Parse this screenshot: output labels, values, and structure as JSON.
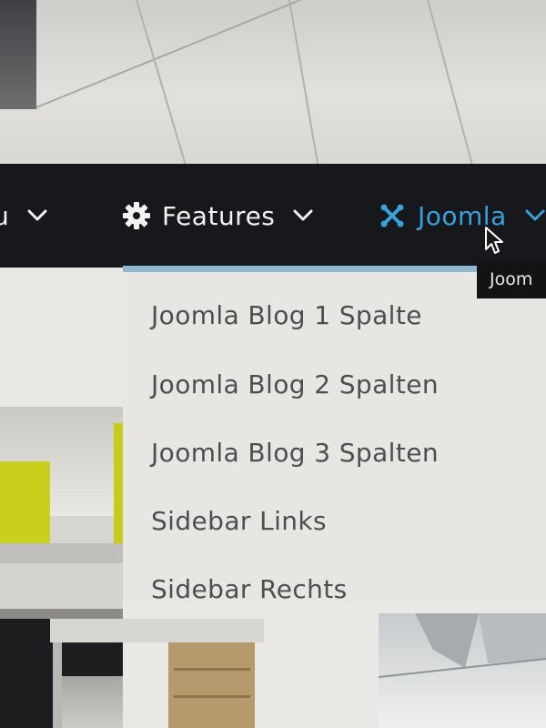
{
  "navbar": {
    "items": [
      {
        "label": "u",
        "icon": "chevron-down-icon"
      },
      {
        "label": "Features",
        "icon": "gear-icon"
      },
      {
        "label": "Joomla",
        "icon": "joomla-logo-icon"
      }
    ],
    "active_color": "#3aa0dc",
    "background": "#16181b"
  },
  "tooltip": {
    "text": "Joom"
  },
  "dropdown": {
    "accent_color": "#8fb8d0",
    "items": [
      {
        "label": "Joomla Blog 1 Spalte"
      },
      {
        "label": "Joomla Blog 2 Spalten"
      },
      {
        "label": "Joomla Blog 3 Spalten"
      },
      {
        "label": "Sidebar Links"
      },
      {
        "label": "Sidebar Rechts"
      }
    ]
  }
}
